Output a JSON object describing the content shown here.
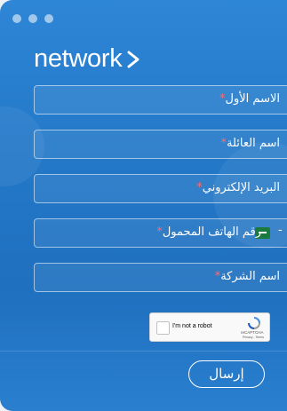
{
  "brand": {
    "name": "network"
  },
  "form": {
    "first_name_label": "الاسم الأول",
    "last_name_label": "اسم العائلة",
    "email_label": "البريد الإلكتروني",
    "phone_label": "رقم الهاتف المحمول",
    "phone_separator": "-",
    "company_label": "اسم الشركة",
    "required_mark": "*",
    "submit_label": "إرسال"
  },
  "captcha": {
    "checkbox_label": "I'm not a robot",
    "brand": "reCAPTCHA",
    "links": "Privacy - Terms"
  },
  "colors": {
    "background": "#2479c9",
    "required": "#ff6b6b",
    "flag": "#1b7a3e"
  }
}
